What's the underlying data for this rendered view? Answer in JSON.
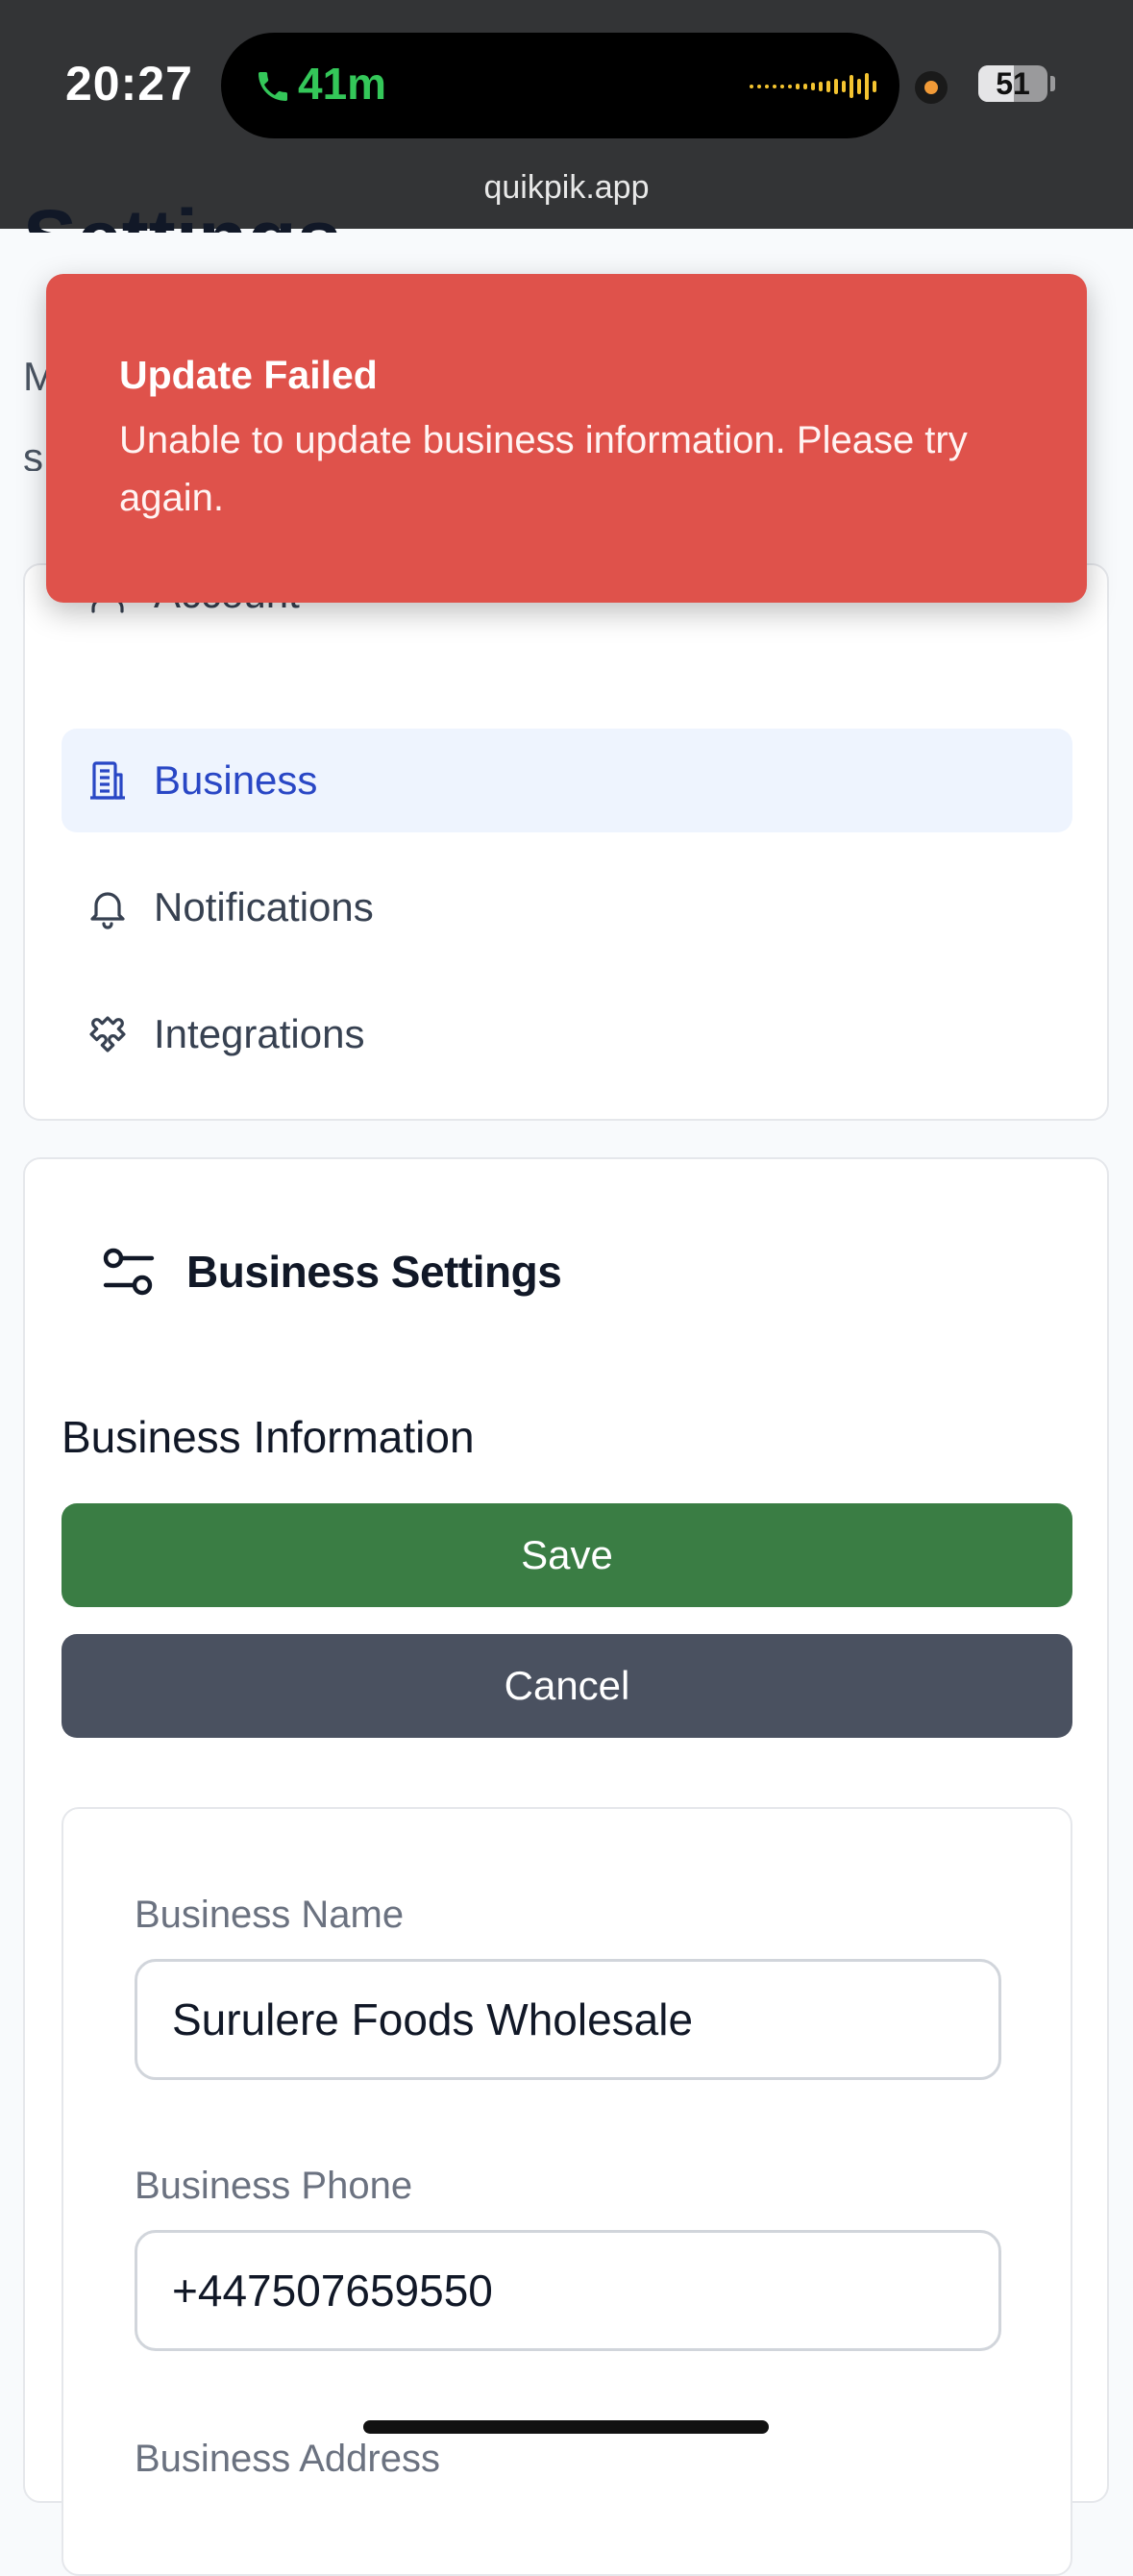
{
  "status_bar": {
    "time": "20:27",
    "call_duration": "41m",
    "battery": "51",
    "url": "quikpik.app"
  },
  "page": {
    "title": "Settings",
    "subtitle": "M s"
  },
  "toast": {
    "title": "Update Failed",
    "message": "Unable to update business information. Please try again."
  },
  "nav": {
    "items": [
      {
        "label": "Account",
        "icon": "user-icon",
        "active": false
      },
      {
        "label": "Business",
        "icon": "building-icon",
        "active": true
      },
      {
        "label": "Notifications",
        "icon": "bell-icon",
        "active": false
      },
      {
        "label": "Integrations",
        "icon": "puzzle-icon",
        "active": false
      }
    ]
  },
  "business_settings": {
    "title": "Business Settings",
    "icon": "sliders-icon",
    "section_title": "Business Information",
    "save_label": "Save",
    "cancel_label": "Cancel",
    "fields": [
      {
        "label": "Business Name",
        "value": "Surulere Foods Wholesale"
      },
      {
        "label": "Business Phone",
        "value": "+447507659550"
      },
      {
        "label": "Business Address",
        "value": ""
      }
    ]
  },
  "colors": {
    "toast_bg": "#df524b",
    "save_bg": "#3a7d44",
    "cancel_bg": "#4a5160",
    "active_nav_bg": "#eef4fe",
    "active_nav_text": "#2947c5"
  }
}
